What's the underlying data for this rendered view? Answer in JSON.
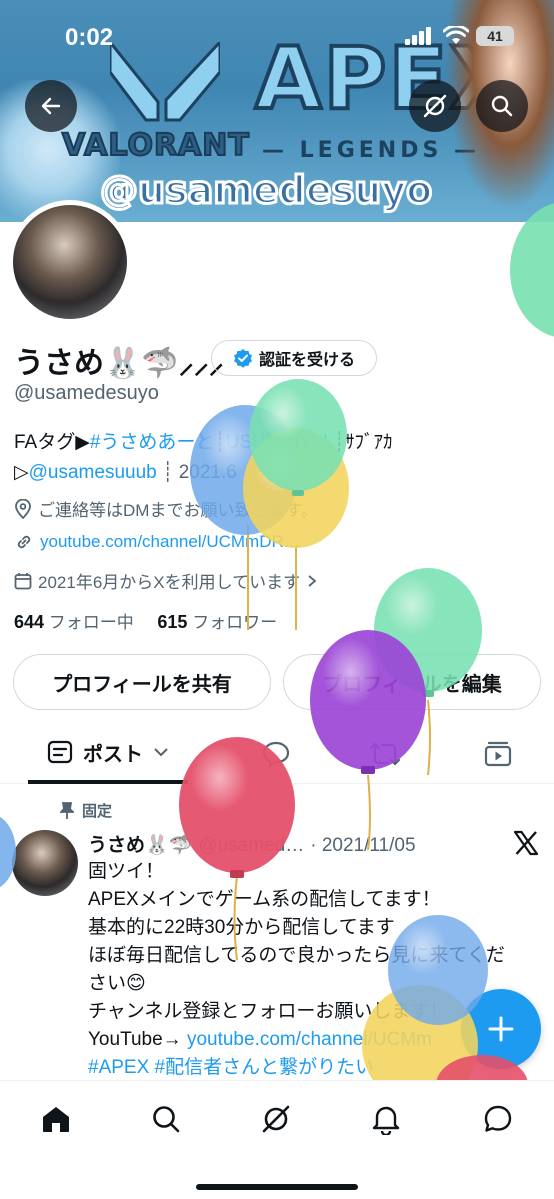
{
  "status_bar": {
    "time": "0:02",
    "battery": "41"
  },
  "banner": {
    "valorant": "VALORANT",
    "apex": "APEX",
    "legends": "— LEGENDS —",
    "handle": "@usamedesuyo"
  },
  "profile": {
    "display_name": "うさめ🐰🦈⸝⸝⸝",
    "verify_label": "認証を受ける",
    "username": "@usamedesuyo",
    "bio_prefix": "FAタグ▶",
    "bio_tag": "#うさめあーと",
    "bio_mid": "┊",
    "bio_tag2": "USUMEIY_L",
    "bio_suffix": "┊ｻﾌﾞｱｶ",
    "bio_sub_prefix": "▷",
    "bio_sub_link": "@usamesuuub",
    "bio_sub_suffix": "┊ 2021.6",
    "contact": "ご連絡等はDMまでお願い致します。",
    "url": "youtube.com/channel/UCMmDR…",
    "joined": "2021年6月からXを利用しています",
    "following_count": "644",
    "following_label": "フォロー中",
    "followers_count": "615",
    "followers_label": "フォロワー",
    "share_label": "プロフィールを共有",
    "edit_label": "プロフィールを編集"
  },
  "tabs": {
    "posts": "ポスト"
  },
  "post": {
    "pinned_label": "固定",
    "author": "うさめ🐰🦈",
    "handle": "@usamed…",
    "date": "· 2021/11/05",
    "lines": [
      "固ツイ！",
      "APEXメインでゲーム系の配信してます！",
      "基本的に22時30分から配信してます",
      "ほぼ毎日配信してるので良かったら見に来てくだ",
      "さい😊",
      "チャンネル登録とフォローお願いします！"
    ],
    "yt_prefix": "YouTube→ ",
    "yt_link": "youtube.com/channel/UCMm",
    "hashtags": "#APEX  #配信者さんと繋がりたい"
  },
  "colors": {
    "accent": "#1d9bf0",
    "text": "#0f1419",
    "muted": "#536471",
    "balloon_blue": "#6fa8ea",
    "balloon_green": "#78e0b0",
    "balloon_yellow": "#f2d45c",
    "balloon_purple": "#9b45d6",
    "balloon_red": "#e5506a"
  }
}
